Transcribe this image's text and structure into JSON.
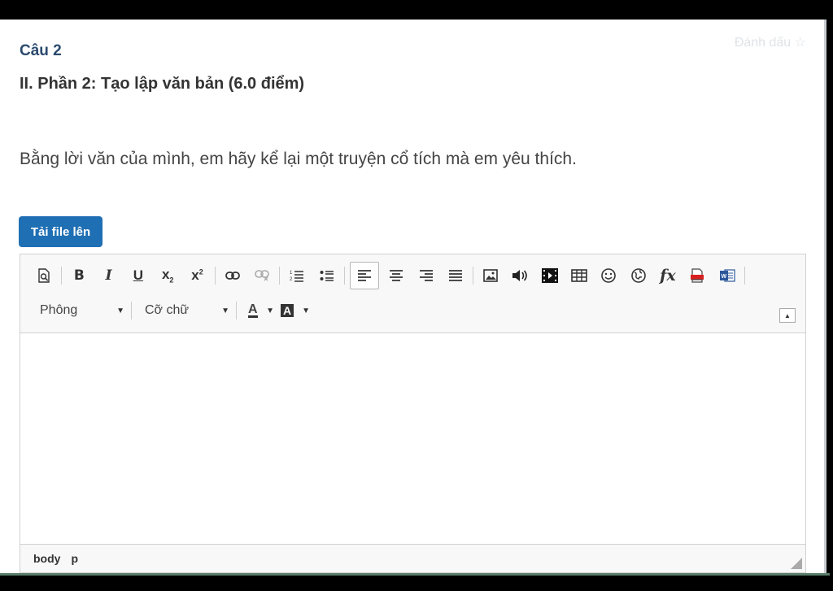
{
  "question": {
    "number": "Câu 2",
    "bookmark_label": "Đánh dấu ☆",
    "title": "II. Phần 2: Tạo lập văn bản (6.0 điểm)",
    "prompt": "Bằng lời văn của mình, em hãy kể lại một truyện cổ tích mà em yêu thích."
  },
  "upload_button": "Tải file lên",
  "editor": {
    "toolbar_row1": [
      {
        "icon": "preview-icon"
      },
      {
        "icon": "bold-icon",
        "label": "B"
      },
      {
        "icon": "italic-icon",
        "label": "I"
      },
      {
        "icon": "underline-icon",
        "label": "U"
      },
      {
        "icon": "subscript-icon"
      },
      {
        "icon": "superscript-icon"
      },
      {
        "icon": "link-icon"
      },
      {
        "icon": "unlink-icon"
      },
      {
        "icon": "ordered-list-icon"
      },
      {
        "icon": "bullet-list-icon"
      },
      {
        "icon": "align-left-icon"
      },
      {
        "icon": "align-center-icon"
      },
      {
        "icon": "align-right-icon"
      },
      {
        "icon": "align-justify-icon"
      },
      {
        "icon": "image-icon"
      },
      {
        "icon": "audio-icon"
      },
      {
        "icon": "video-icon"
      },
      {
        "icon": "table-icon"
      },
      {
        "icon": "emoticon-icon"
      },
      {
        "icon": "globe-icon"
      },
      {
        "icon": "formula-icon",
        "label": "fx"
      },
      {
        "icon": "pdf-icon"
      },
      {
        "icon": "word-icon"
      }
    ],
    "font_family": "Phông",
    "font_size": "Cỡ chữ",
    "text_color_label": "A",
    "bg_color_label": "A",
    "status_path": [
      "body",
      "p"
    ]
  }
}
